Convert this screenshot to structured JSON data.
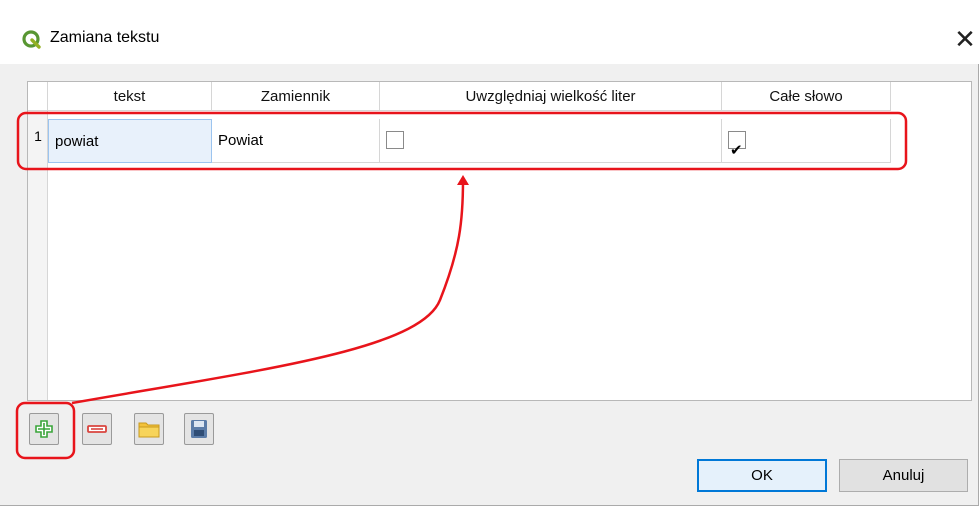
{
  "window": {
    "title": "Zamiana tekstu",
    "close_glyph": "✕"
  },
  "table": {
    "columns": [
      "tekst",
      "Zamiennik",
      "Uwzględniaj wielkość liter",
      "Całe słowo"
    ],
    "rows": [
      {
        "number": "1",
        "tekst": "powiat",
        "zamiennik": "Powiat",
        "case_sensitive": false,
        "whole_word": true
      }
    ]
  },
  "toolbar": {
    "icons": [
      "add-icon",
      "remove-icon",
      "open-folder-icon",
      "save-icon"
    ]
  },
  "buttons": {
    "ok": "OK",
    "cancel": "Anuluj"
  },
  "colors": {
    "annotation": "#e8141b",
    "accent": "#0078d7",
    "add_green": "#3aa53a",
    "remove_red": "#d9443e",
    "folder_yellow": "#f3c23a",
    "save_blue": "#5b7ca8"
  }
}
